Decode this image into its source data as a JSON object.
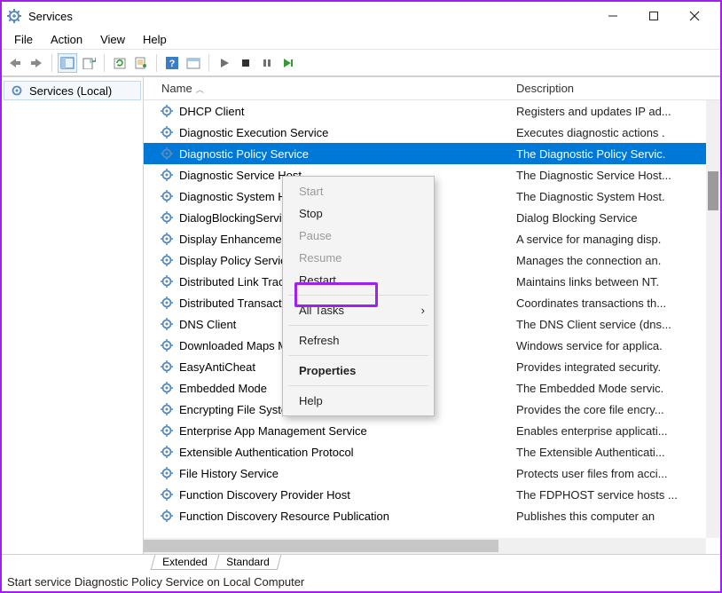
{
  "titlebar": {
    "title": "Services"
  },
  "menubar": {
    "items": [
      "File",
      "Action",
      "View",
      "Help"
    ]
  },
  "left_pane": {
    "item": "Services (Local)"
  },
  "columns": {
    "name": "Name",
    "description": "Description"
  },
  "selected_index": 2,
  "services": [
    {
      "name": "DHCP Client",
      "desc": "Registers and updates IP ad..."
    },
    {
      "name": "Diagnostic Execution Service",
      "desc": "Executes diagnostic actions ."
    },
    {
      "name": "Diagnostic Policy Service",
      "desc": "The Diagnostic Policy Servic."
    },
    {
      "name": "Diagnostic Service Host",
      "desc": "The Diagnostic Service Host..."
    },
    {
      "name": "Diagnostic System Host",
      "desc": "The Diagnostic System Host."
    },
    {
      "name": "DialogBlockingService",
      "desc": "Dialog Blocking Service"
    },
    {
      "name": "Display Enhancement Service",
      "desc": "A service for managing disp."
    },
    {
      "name": "Display Policy Service",
      "desc": "Manages the connection an."
    },
    {
      "name": "Distributed Link Tracking Client",
      "desc": "Maintains links between NT."
    },
    {
      "name": "Distributed Transaction Coordinator",
      "desc": "Coordinates transactions th..."
    },
    {
      "name": "DNS Client",
      "desc": "The DNS Client service (dns..."
    },
    {
      "name": "Downloaded Maps Manager",
      "desc": "Windows service for applica."
    },
    {
      "name": "EasyAntiCheat",
      "desc": "Provides integrated security."
    },
    {
      "name": "Embedded Mode",
      "desc": "The Embedded Mode servic."
    },
    {
      "name": "Encrypting File System (EFS)",
      "desc": "Provides the core file encry..."
    },
    {
      "name": "Enterprise App Management Service",
      "desc": "Enables enterprise applicati..."
    },
    {
      "name": "Extensible Authentication Protocol",
      "desc": "The Extensible Authenticati..."
    },
    {
      "name": "File History Service",
      "desc": "Protects user files from acci..."
    },
    {
      "name": "Function Discovery Provider Host",
      "desc": "The FDPHOST service hosts ..."
    },
    {
      "name": "Function Discovery Resource Publication",
      "desc": "Publishes this computer an"
    }
  ],
  "context_menu": {
    "start": "Start",
    "stop": "Stop",
    "pause": "Pause",
    "resume": "Resume",
    "restart": "Restart",
    "all_tasks": "All Tasks",
    "refresh": "Refresh",
    "properties": "Properties",
    "help": "Help"
  },
  "tabs": {
    "extended": "Extended",
    "standard": "Standard"
  },
  "statusbar": {
    "text": "Start service Diagnostic Policy Service on Local Computer"
  }
}
